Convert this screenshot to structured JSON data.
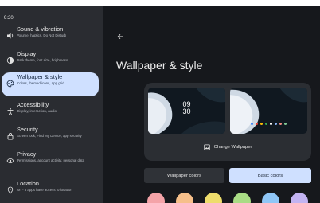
{
  "status": {
    "time": "9:20"
  },
  "sidebar": {
    "items": [
      {
        "icon": "speaker-icon",
        "title": "Sound & vibration",
        "sub": "Volume, haptics, Do Not Disturb"
      },
      {
        "icon": "display-icon",
        "title": "Display",
        "sub": "Dark theme, font size, brightness"
      },
      {
        "icon": "palette-icon",
        "title": "Wallpaper & style",
        "sub": "Colors, themed icons, app grid"
      },
      {
        "icon": "accessibility-icon",
        "title": "Accessibility",
        "sub": "Display, interaction, audio"
      },
      {
        "icon": "lock-icon",
        "title": "Security",
        "sub": "Screen lock, Find My Device, app security"
      },
      {
        "icon": "privacy-icon",
        "title": "Privacy",
        "sub": "Permissions, account activity, personal data"
      },
      {
        "icon": "location-icon",
        "title": "Location",
        "sub": "On - 5 apps have access to location"
      }
    ],
    "selected_index": 2
  },
  "main": {
    "title": "Wallpaper & style",
    "lock_clock": {
      "hours": "09",
      "minutes": "30"
    },
    "change_wallpaper_label": "Change Wallpaper",
    "tabs": {
      "wallpaper_colors": "Wallpaper colors",
      "basic_colors": "Basic colors"
    },
    "selected_tab": "basic_colors"
  },
  "swatches": [
    "#f4a3a8",
    "#f6bf8a",
    "#eedd6c",
    "#a9dc85",
    "#8fc6f6",
    "#c2b3f1"
  ],
  "colors": {
    "accent": "#cfe0ff",
    "background": "#16181c",
    "panel": "#2a2c31"
  }
}
